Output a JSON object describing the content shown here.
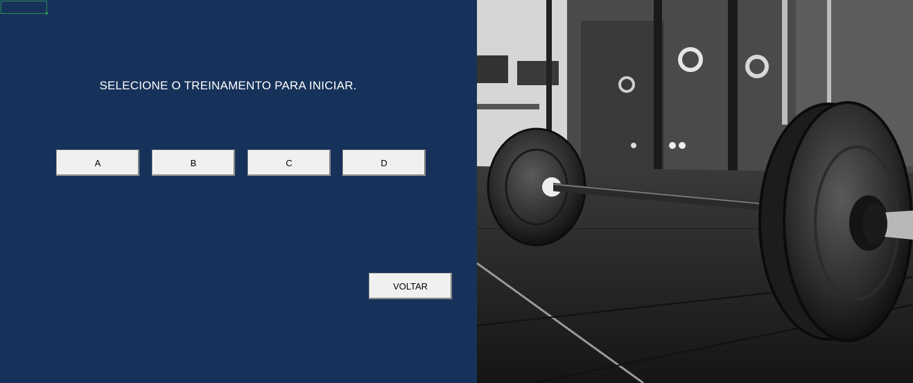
{
  "heading": "SELECIONE O TREINAMENTO PARA INICIAR.",
  "options": [
    {
      "label": "A"
    },
    {
      "label": "B"
    },
    {
      "label": "C"
    },
    {
      "label": "D"
    }
  ],
  "back_button": "VOLTAR",
  "colors": {
    "panel_background": "#17325a",
    "button_background": "#f0f0f0",
    "heading_text": "#ffffff"
  }
}
